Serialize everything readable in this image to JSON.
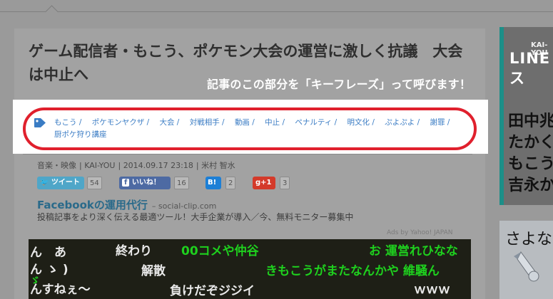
{
  "article": {
    "title": "ゲーム配信者・もこう、ポケモン大会の運営に激しく抗議　大会は中止へ",
    "annotation": "記事のこの部分を「キーフレーズ」って呼びます！",
    "tags": [
      "もこう",
      "ポケモンヤクザ",
      "大会",
      "対戦相手",
      "動画",
      "中止",
      "ペナルティ",
      "明文化",
      "ぷよぷよ",
      "謝罪",
      "厨ポケ狩り講座"
    ],
    "meta": {
      "category": "音楽・映像",
      "source": "KAI-YOU",
      "date": "2014.09.17 23:18",
      "author": "米村 智水"
    },
    "share": {
      "tweet_label": "ツイート",
      "tweet_count": "54",
      "like_label": "いいね！",
      "like_count": "16",
      "hatena_label": "B!",
      "hatena_count": "2",
      "gplus_label": "g+1",
      "gplus_count": "3"
    },
    "ad": {
      "title": "Facebookの運用代行",
      "domain": "– social-clip.com",
      "description": "投稿記事をより深く伝える最適ツール！大手企業が導入／今、無料モニター募集中",
      "credit": "Ads by Yahoo! JAPAN"
    },
    "video_comments": [
      {
        "text": "ん　あ",
        "color": "white"
      },
      {
        "text": "終わり",
        "color": "white"
      },
      {
        "text": "00コメや仲谷",
        "color": "green"
      },
      {
        "text": "お 運営れひなな",
        "color": "green"
      },
      {
        "text": "ん ゝ )",
        "color": "white"
      },
      {
        "text": "解散",
        "color": "white"
      },
      {
        "text": "きもこうがまたなんかや 維騒ん",
        "color": "green"
      },
      {
        "text": "んすねぇ～",
        "color": "white"
      },
      {
        "text": "負けだぞジジイ",
        "color": "white"
      },
      {
        "text": "ｗｗｗ",
        "color": "white"
      },
      {
        "text": "ゞ",
        "color": "green"
      }
    ]
  },
  "sidebar": {
    "ad1": {
      "brand": "KAI-YOU",
      "headline": "LINE ス",
      "lines": [
        "田中兆",
        "たかく",
        "もこう",
        "吉永か"
      ]
    },
    "ad2": {
      "text": "さよな"
    }
  },
  "colors": {
    "highlight_ring": "#e0202d",
    "tag_link": "#3a7cc4",
    "twitter": "#4fa6c8",
    "facebook": "#4d6aa3",
    "hatena": "#1c7fd6",
    "gplus": "#d43a2a"
  }
}
